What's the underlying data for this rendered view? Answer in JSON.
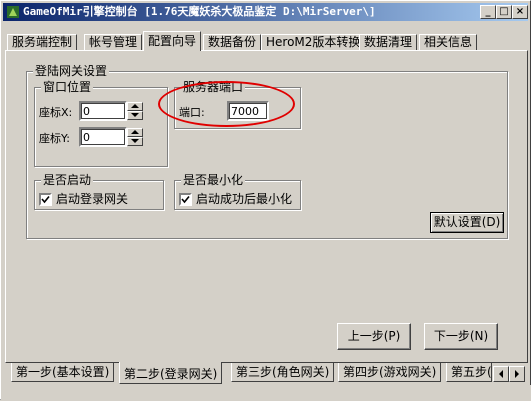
{
  "window": {
    "title": "GameOfMir引擎控制台 [1.76天魔妖杀大极品鉴定 D:\\MirServer\\]",
    "controls": {
      "minimize": "_",
      "maximize": "□",
      "close": "×"
    }
  },
  "top_tabs": [
    {
      "label": "服务端控制"
    },
    {
      "label": "帐号管理"
    },
    {
      "label": "配置向导",
      "active": true
    },
    {
      "label": "数据备份"
    },
    {
      "label": "HeroM2版本转换"
    },
    {
      "label": "数据清理"
    },
    {
      "label": "相关信息"
    }
  ],
  "login_gate": {
    "group_title": "登陆网关设置",
    "window_pos": {
      "title": "窗口位置",
      "x_label": "座标X:",
      "x_value": "0",
      "y_label": "座标Y:",
      "y_value": "0"
    },
    "server_port": {
      "title": "服务器端口",
      "port_label": "端口:",
      "port_value": "7000"
    },
    "autostart": {
      "title": "是否启动",
      "checkbox_label": "启动登录网关",
      "checked": true
    },
    "minimize": {
      "title": "是否最小化",
      "checkbox_label": "启动成功后最小化",
      "checked": true
    },
    "default_button": "默认设置(D)"
  },
  "nav": {
    "prev": "上一步(P)",
    "next": "下一步(N)"
  },
  "bottom_tabs": [
    {
      "label": "第一步(基本设置)"
    },
    {
      "label": "第二步(登录网关)",
      "active": true
    },
    {
      "label": "第三步(角色网关)"
    },
    {
      "label": "第四步(游戏网关)"
    },
    {
      "label": "第五步("
    }
  ],
  "colors": {
    "face": "#d4d0c8",
    "title_start": "#0a246a",
    "title_end": "#a6caf0",
    "annotation": "#e00000"
  }
}
